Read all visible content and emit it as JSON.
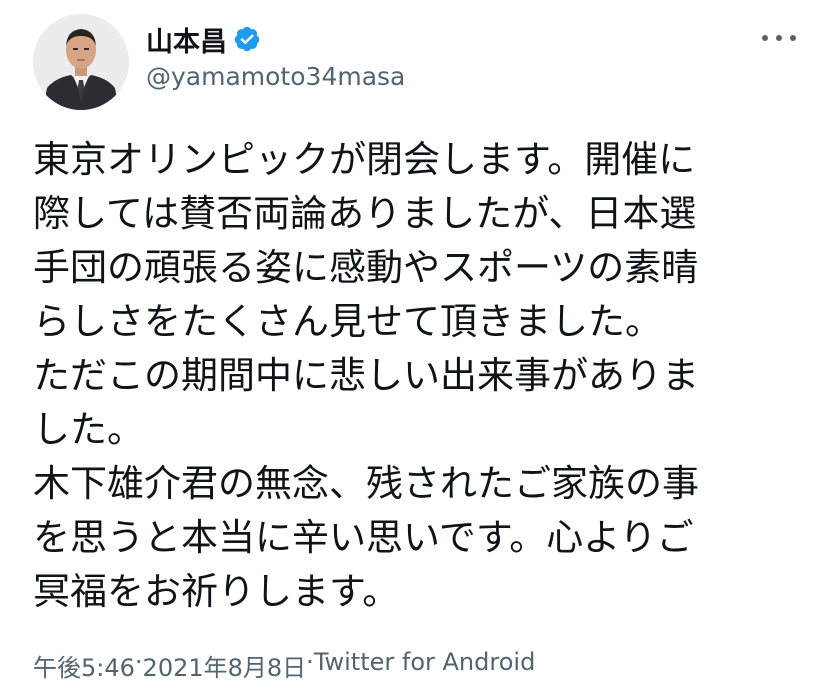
{
  "author": {
    "display_name": "山本昌",
    "handle": "@yamamoto34masa",
    "verified": true,
    "avatar_icon": "profile-photo"
  },
  "tweet": {
    "text": "東京オリンピックが閉会します。開催に\n際しては賛否両論ありましたが、日本選\n手団の頑張る姿に感動やスポーツの素晴\nらしさをたくさん見せて頂きました。\nただこの期間中に悲しい出来事がありま\nした。\n木下雄介君の無念、残されたご家族の事\nを思うと本当に辛い思いです。心よりご\n冥福をお祈りします。",
    "time": "午後5:46",
    "separator": " · ",
    "date": "2021年8月8日",
    "source": "Twitter for Android"
  },
  "colors": {
    "text": "#0f1419",
    "secondary": "#536471",
    "verified_badge": "#1d9bf0",
    "background": "#ffffff"
  },
  "icons": {
    "more": "more-horizontal-icon",
    "verified": "verified-badge-icon"
  }
}
